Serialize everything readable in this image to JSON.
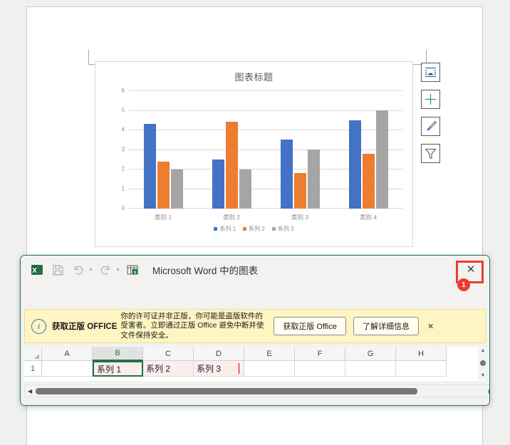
{
  "document": {
    "page_label": "word-document-page"
  },
  "chart": {
    "title": "图表标题",
    "side_buttons": [
      {
        "name": "layout-options-icon",
        "label": "布局选项"
      },
      {
        "name": "chart-elements-icon",
        "label": "图表元素"
      },
      {
        "name": "chart-styles-icon",
        "label": "图表样式"
      },
      {
        "name": "chart-filters-icon",
        "label": "图表筛选器"
      }
    ]
  },
  "chart_data": {
    "type": "bar",
    "title": "图表标题",
    "xlabel": "",
    "ylabel": "",
    "categories": [
      "类别 1",
      "类别 2",
      "类别 3",
      "类别 4"
    ],
    "series": [
      {
        "name": "系列 1",
        "color": "#4472C4",
        "values": [
          4.3,
          2.5,
          3.5,
          4.5
        ]
      },
      {
        "name": "系列 2",
        "color": "#ED7D31",
        "values": [
          2.4,
          4.4,
          1.8,
          2.8
        ]
      },
      {
        "name": "系列 3",
        "color": "#A5A5A5",
        "values": [
          2.0,
          2.0,
          3.0,
          5.0
        ]
      }
    ],
    "ylim": [
      0,
      6
    ],
    "yticks": [
      0,
      1,
      2,
      3,
      4,
      5,
      6
    ],
    "grid": true,
    "legend_position": "bottom"
  },
  "excel_window": {
    "title": "Microsoft Word 中的图表",
    "quick_access": [
      {
        "name": "excel-app-icon",
        "label": "Excel"
      },
      {
        "name": "save-icon",
        "label": "保存"
      },
      {
        "name": "undo-icon",
        "label": "撤消"
      },
      {
        "name": "redo-icon",
        "label": "恢复"
      },
      {
        "name": "edit-data-icon",
        "label": "编辑数据"
      }
    ],
    "close_label": "✕",
    "close_badge": "1"
  },
  "license_banner": {
    "heading": "获取正版 OFFICE",
    "body": "你的许可证并非正版，你可能是盗版软件的受害者。立即通过正版 Office 避免中断并使文件保持安全。",
    "primary_button": "获取正版 Office",
    "secondary_button": "了解详细信息",
    "close_label": "✕",
    "info_icon": "i"
  },
  "sheet": {
    "column_headers": [
      "A",
      "B",
      "C",
      "D",
      "E",
      "F",
      "G",
      "H"
    ],
    "active_column": "B",
    "row_headers": [
      "1"
    ],
    "rows": [
      {
        "cells": [
          "",
          "系列 1",
          "系列 2",
          "系列 3",
          "",
          "",
          "",
          ""
        ]
      }
    ]
  }
}
